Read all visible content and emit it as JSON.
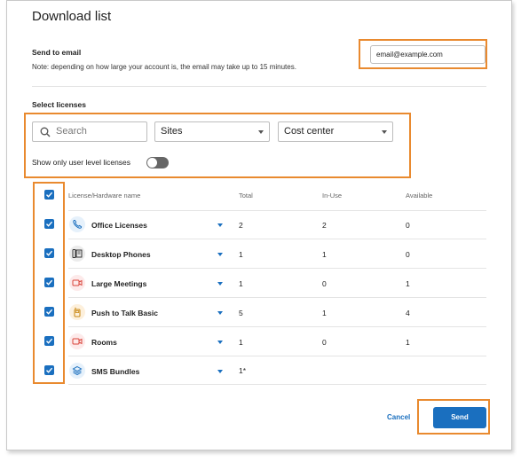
{
  "dialog": {
    "title": "Download list"
  },
  "email": {
    "section_label": "Send to email",
    "note": "Note: depending on how large your account is, the email may take up to 15 minutes.",
    "value": "email@example.com"
  },
  "licenses": {
    "section_label": "Select licenses",
    "search_placeholder": "Search",
    "sites_selected": "Sites",
    "cost_center_selected": "Cost center",
    "toggle_label": "Show only user level licenses",
    "toggle_on": false
  },
  "table": {
    "headers": {
      "name": "License/Hardware name",
      "total": "Total",
      "inuse": "In-Use",
      "available": "Available"
    },
    "rows": [
      {
        "name": "Office Licenses",
        "icon": "phone-icon",
        "total": "2",
        "inuse": "2",
        "available": "0",
        "checked": true
      },
      {
        "name": "Desktop Phones",
        "icon": "desk-phone-icon",
        "total": "1",
        "inuse": "1",
        "available": "0",
        "checked": true
      },
      {
        "name": "Large Meetings",
        "icon": "video-camera-icon",
        "total": "1",
        "inuse": "0",
        "available": "1",
        "checked": true
      },
      {
        "name": "Push to Talk Basic",
        "icon": "walkie-talkie-icon",
        "total": "5",
        "inuse": "1",
        "available": "4",
        "checked": true
      },
      {
        "name": "Rooms",
        "icon": "video-camera-icon",
        "total": "1",
        "inuse": "0",
        "available": "1",
        "checked": true
      },
      {
        "name": "SMS Bundles",
        "icon": "layers-icon",
        "total": "1*",
        "inuse": "",
        "available": "",
        "checked": true
      }
    ]
  },
  "footer": {
    "cancel_label": "Cancel",
    "send_label": "Send"
  },
  "colors": {
    "accent": "#1a6fbf",
    "highlight": "#e98a2f"
  }
}
